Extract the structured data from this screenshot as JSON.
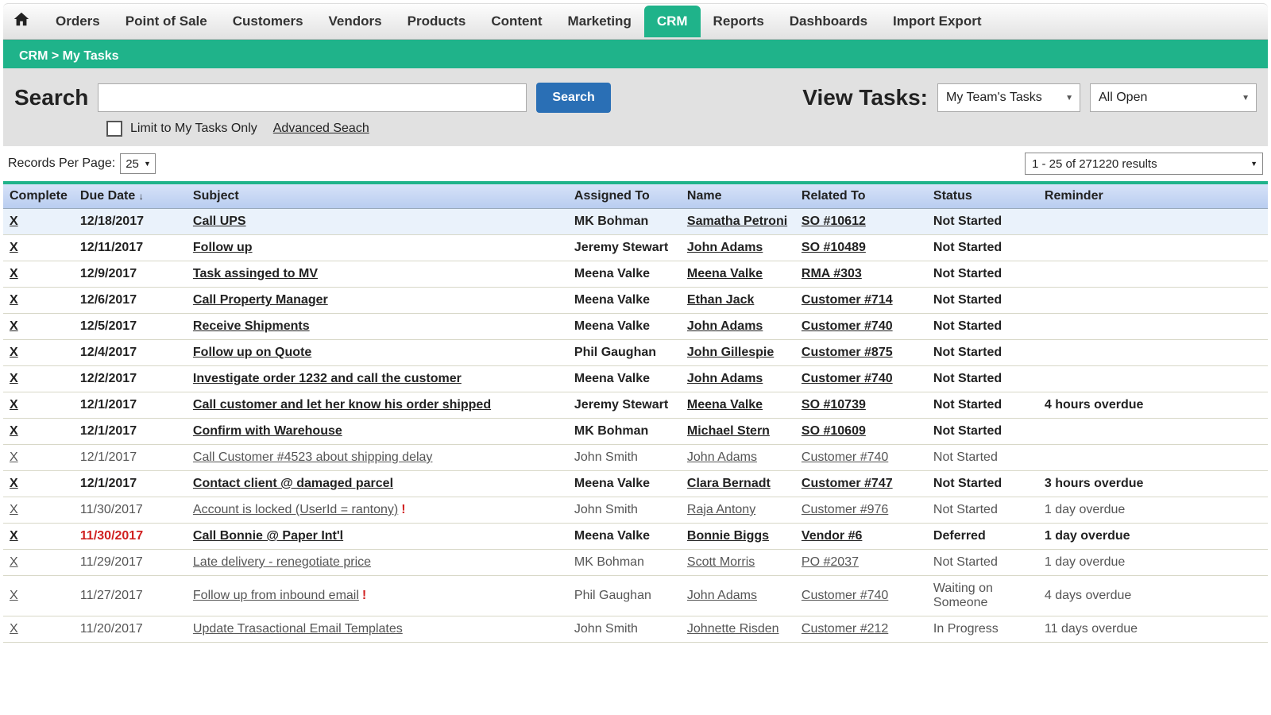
{
  "nav": {
    "items": [
      "Orders",
      "Point of Sale",
      "Customers",
      "Vendors",
      "Products",
      "Content",
      "Marketing",
      "CRM",
      "Reports",
      "Dashboards",
      "Import Export"
    ],
    "active": "CRM"
  },
  "breadcrumb": "CRM > My Tasks",
  "search": {
    "label": "Search",
    "button": "Search",
    "limit_label": "Limit to My Tasks Only",
    "advanced": "Advanced Seach",
    "view_label": "View Tasks:",
    "view_dropdown": "My Team's Tasks",
    "filter_dropdown": "All Open"
  },
  "pager": {
    "rpp_label": "Records Per Page:",
    "rpp_value": "25",
    "results": "1 - 25 of 271220 results"
  },
  "table": {
    "headers": {
      "complete": "Complete",
      "due": "Due Date",
      "subject": "Subject",
      "assigned": "Assigned To",
      "name": "Name",
      "related": "Related To",
      "status": "Status",
      "reminder": "Reminder"
    },
    "sort_icon": "↓",
    "rows": [
      {
        "x": "X",
        "due": "12/18/2017",
        "subject": "Call UPS",
        "assigned": "MK Bohman",
        "name": "Samatha Petroni",
        "related": "SO #10612",
        "status": "Not Started",
        "reminder": "",
        "muted": false,
        "red": false,
        "alert": false,
        "highlight": true
      },
      {
        "x": "X",
        "due": "12/11/2017",
        "subject": "Follow up",
        "assigned": "Jeremy Stewart",
        "name": "John Adams",
        "related": "SO #10489",
        "status": "Not Started",
        "reminder": "",
        "muted": false,
        "red": false,
        "alert": false
      },
      {
        "x": "X",
        "due": "12/9/2017",
        "subject": "Task assinged to MV",
        "assigned": "Meena Valke",
        "name": "Meena Valke",
        "related": "RMA #303",
        "status": "Not Started",
        "reminder": "",
        "muted": false,
        "red": false,
        "alert": false
      },
      {
        "x": "X",
        "due": "12/6/2017",
        "subject": "Call Property Manager",
        "assigned": "Meena Valke",
        "name": "Ethan Jack",
        "related": "Customer #714",
        "status": "Not Started",
        "reminder": "",
        "muted": false,
        "red": false,
        "alert": false
      },
      {
        "x": "X",
        "due": "12/5/2017",
        "subject": "Receive Shipments",
        "assigned": "Meena Valke",
        "name": "John Adams",
        "related": "Customer #740",
        "status": "Not Started",
        "reminder": "",
        "muted": false,
        "red": false,
        "alert": false
      },
      {
        "x": "X",
        "due": "12/4/2017",
        "subject": "Follow up on Quote",
        "assigned": "Phil Gaughan",
        "name": "John Gillespie",
        "related": "Customer #875",
        "status": "Not Started",
        "reminder": "",
        "muted": false,
        "red": false,
        "alert": false
      },
      {
        "x": "X",
        "due": "12/2/2017",
        "subject": "Investigate order 1232 and call the customer",
        "assigned": "Meena Valke",
        "name": "John Adams",
        "related": "Customer #740",
        "status": "Not Started",
        "reminder": "",
        "muted": false,
        "red": false,
        "alert": false
      },
      {
        "x": "X",
        "due": "12/1/2017",
        "subject": "Call customer and let her know his order shipped",
        "assigned": "Jeremy Stewart",
        "name": "Meena Valke",
        "related": "SO #10739",
        "status": "Not Started",
        "reminder": "4 hours overdue",
        "muted": false,
        "red": false,
        "alert": false
      },
      {
        "x": "X",
        "due": "12/1/2017",
        "subject": "Confirm with Warehouse",
        "assigned": "MK Bohman",
        "name": "Michael Stern",
        "related": "SO #10609",
        "status": "Not Started",
        "reminder": "",
        "muted": false,
        "red": false,
        "alert": false
      },
      {
        "x": "X",
        "due": "12/1/2017",
        "subject": "Call Customer #4523 about shipping delay",
        "assigned": "John Smith",
        "name": "John Adams",
        "related": "Customer #740",
        "status": "Not Started",
        "reminder": "",
        "muted": true,
        "red": false,
        "alert": false
      },
      {
        "x": "X",
        "due": "12/1/2017",
        "subject": "Contact client @ damaged parcel",
        "assigned": "Meena Valke",
        "name": "Clara Bernadt",
        "related": "Customer #747",
        "status": "Not Started",
        "reminder": "3 hours overdue",
        "muted": false,
        "red": false,
        "alert": false
      },
      {
        "x": "X",
        "due": "11/30/2017",
        "subject": "Account is locked (UserId = rantony)",
        "assigned": "John Smith",
        "name": "Raja Antony",
        "related": "Customer #976",
        "status": "Not Started",
        "reminder": "1 day overdue",
        "muted": true,
        "red": true,
        "alert": true
      },
      {
        "x": "X",
        "due": "11/30/2017",
        "subject": "Call Bonnie @ Paper Int'l",
        "assigned": "Meena Valke",
        "name": "Bonnie Biggs",
        "related": "Vendor #6",
        "status": "Deferred",
        "reminder": "1 day overdue",
        "muted": false,
        "red": true,
        "alert": false
      },
      {
        "x": "X",
        "due": "11/29/2017",
        "subject": "Late delivery - renegotiate price",
        "assigned": "MK Bohman",
        "name": "Scott Morris",
        "related": "PO #2037",
        "status": "Not Started",
        "reminder": "1 day overdue",
        "muted": true,
        "red": true,
        "alert": false
      },
      {
        "x": "X",
        "due": "11/27/2017",
        "subject": "Follow up from inbound email",
        "assigned": "Phil Gaughan",
        "name": "John Adams",
        "related": "Customer #740",
        "status": "Waiting on Someone",
        "reminder": "4 days overdue",
        "muted": true,
        "red": true,
        "alert": true
      },
      {
        "x": "X",
        "due": "11/20/2017",
        "subject": "Update Trasactional Email Templates",
        "assigned": "John Smith",
        "name": "Johnette Risden",
        "related": "Customer #212",
        "status": "In Progress",
        "reminder": "11 days overdue",
        "muted": true,
        "red": true,
        "alert": false
      }
    ]
  }
}
